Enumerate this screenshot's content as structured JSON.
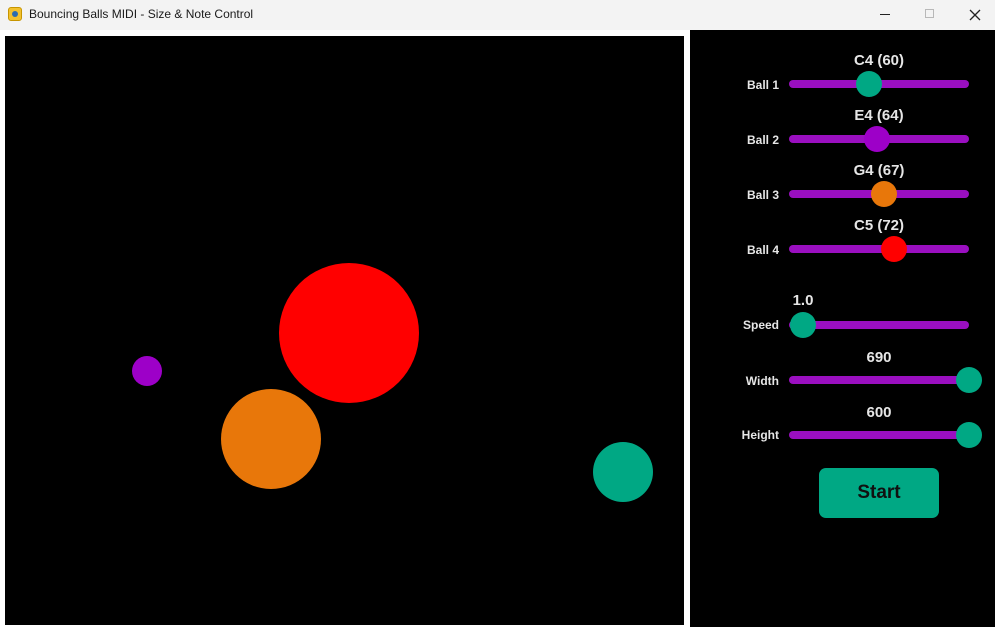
{
  "window": {
    "title": "Bouncing Balls MIDI - Size & Note Control"
  },
  "canvas": {
    "balls": [
      {
        "name": "small-purple",
        "color": "#9d00c8"
      },
      {
        "name": "large-red",
        "color": "#ff0000"
      },
      {
        "name": "orange",
        "color": "#e8770a"
      },
      {
        "name": "green",
        "color": "#00a884"
      }
    ]
  },
  "controls": {
    "notes": [
      {
        "label": "Ball 1",
        "value_text": "C4 (60)",
        "knob_color": "#00a884"
      },
      {
        "label": "Ball 2",
        "value_text": "E4 (64)",
        "knob_color": "#9d00c8"
      },
      {
        "label": "Ball 3",
        "value_text": "G4 (67)",
        "knob_color": "#e8770a"
      },
      {
        "label": "Ball 4",
        "value_text": "C5 (72)",
        "knob_color": "#ff0000"
      }
    ],
    "speed": {
      "label": "Speed",
      "value_text": "1.0",
      "knob_color": "#00a884"
    },
    "width": {
      "label": "Width",
      "value_text": "690",
      "knob_color": "#00a884"
    },
    "height": {
      "label": "Height",
      "value_text": "600",
      "knob_color": "#00a884"
    },
    "start_label": "Start"
  },
  "colors": {
    "slider_track": "#9a0fc0",
    "accent": "#00a884",
    "panel_bg": "#000000"
  }
}
